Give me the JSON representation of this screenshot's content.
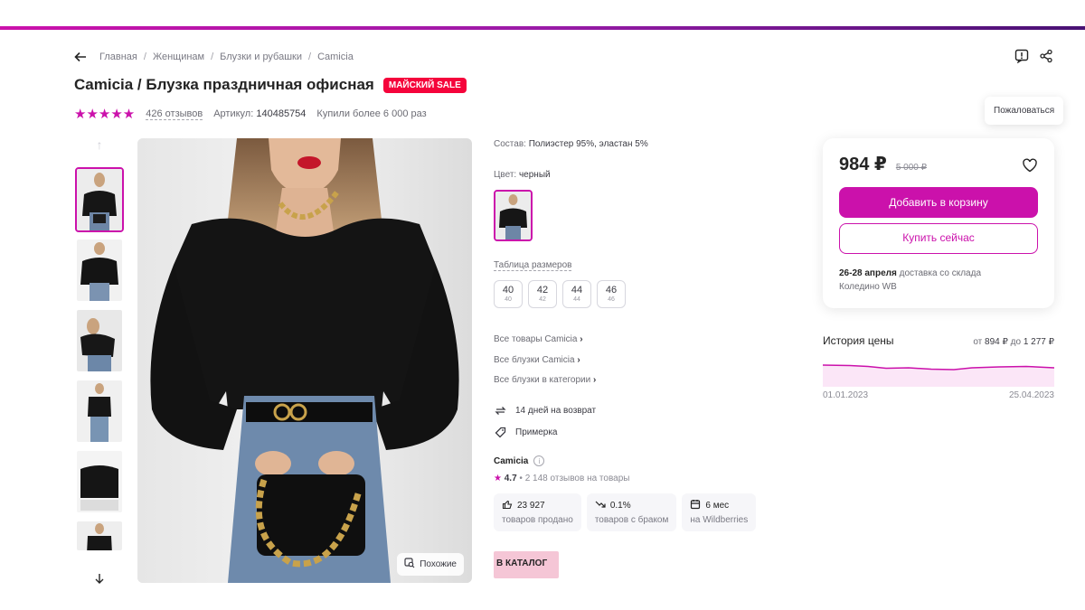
{
  "breadcrumbs": [
    "Главная",
    "Женщинам",
    "Блузки и рубашки",
    "Camicia"
  ],
  "product": {
    "title": "Camicia / Блузка праздничная офисная",
    "sale_badge": "МАЙСКИЙ SALE",
    "rating_stars": 5,
    "reviews": "426 отзывов",
    "article_label": "Артикул:",
    "article": "140485754",
    "bought": "Купили более 6 000 раз"
  },
  "tooltip": "Пожаловаться",
  "similar_label": "Похожие",
  "details": {
    "composition_label": "Состав:",
    "composition": "Полиэстер 95%, эластан 5%",
    "color_label": "Цвет:",
    "color": "черный",
    "size_table": "Таблица размеров",
    "sizes": [
      {
        "n": "40",
        "s": "40"
      },
      {
        "n": "42",
        "s": "42"
      },
      {
        "n": "44",
        "s": "44"
      },
      {
        "n": "46",
        "s": "46"
      }
    ],
    "links": [
      "Все товары Camicia",
      "Все блузки Camicia",
      "Все блузки в категории"
    ],
    "return": "14 дней на возврат",
    "fitting": "Примерка"
  },
  "seller": {
    "name": "Camicia",
    "rating": "4.7",
    "reviews": "2 148 отзывов на товары",
    "stats": [
      {
        "value": "23 927",
        "label": "товаров продано",
        "icon": "thumbs-up-icon"
      },
      {
        "value": "0.1%",
        "label": "товаров с браком",
        "icon": "trend-down-icon"
      },
      {
        "value": "6 мес",
        "label": "на Wildberries",
        "icon": "calendar-icon"
      }
    ],
    "catalog_button": "В КАТАЛОГ"
  },
  "price_card": {
    "price": "984 ₽",
    "old_price": "5 000 ₽",
    "add_to_cart": "Добавить в корзину",
    "buy_now": "Купить сейчас",
    "delivery_date": "26-28 апреля",
    "delivery_text": "доставка со склада",
    "warehouse": "Коледино WB"
  },
  "price_history": {
    "title": "История цены",
    "range_from_label": "от",
    "range_from": "894 ₽",
    "range_to_label": "до",
    "range_to": "1 277 ₽",
    "start_date": "01.01.2023",
    "end_date": "25.04.2023"
  },
  "colors": {
    "brand": "#cb11ab",
    "sale": "#f5043b",
    "catalog_bg": "#f5c6d6"
  }
}
